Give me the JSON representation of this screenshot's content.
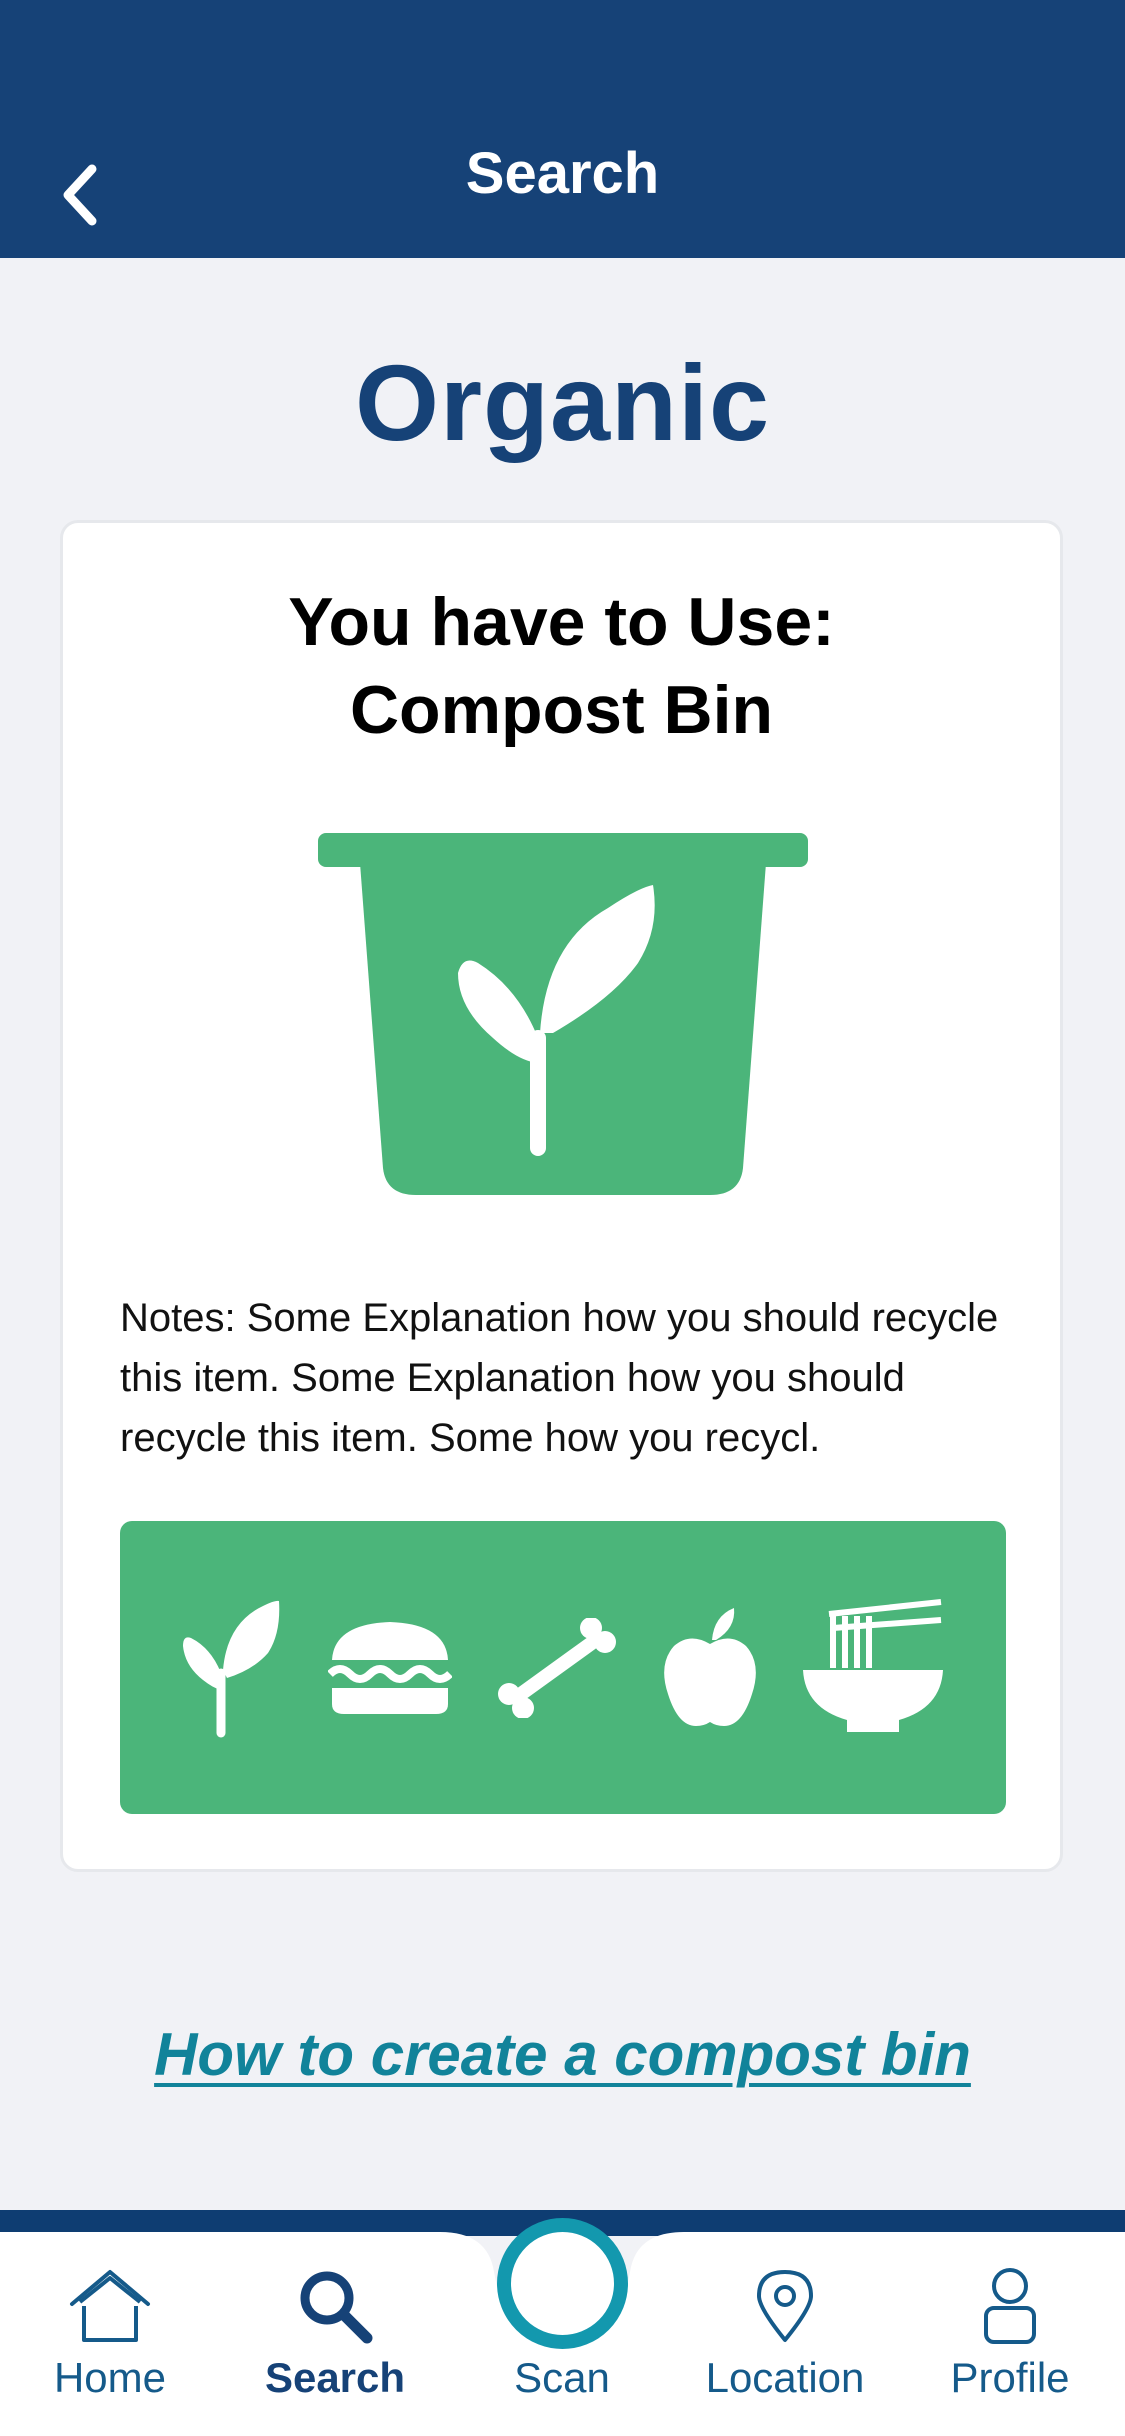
{
  "header": {
    "title": "Search",
    "back_icon": "chevron-left-icon"
  },
  "page": {
    "title": "Organic"
  },
  "card": {
    "heading_line1": "You have to Use:",
    "heading_line2": "Compost Bin",
    "bin_icon": "compost-bin-icon",
    "notes": "Notes: Some Explanation how you should recycle this item. Some Explanation how you should recycle this item. Some how you recycl.",
    "items": [
      {
        "icon": "sprout-icon"
      },
      {
        "icon": "burger-icon"
      },
      {
        "icon": "bone-icon"
      },
      {
        "icon": "apple-icon"
      },
      {
        "icon": "noodle-bowl-icon"
      }
    ]
  },
  "link": {
    "label": "How to create a compost bin"
  },
  "tabbar": {
    "tabs": [
      {
        "label": "Home",
        "icon": "home-icon"
      },
      {
        "label": "Search",
        "icon": "search-icon",
        "active": true
      },
      {
        "label": "Scan",
        "icon": "scan-circle-icon"
      },
      {
        "label": "Location",
        "icon": "location-pin-icon"
      },
      {
        "label": "Profile",
        "icon": "profile-icon"
      }
    ]
  },
  "colors": {
    "header": "#164277",
    "accent_green": "#4bb57a",
    "link": "#11839a",
    "scan_ring": "#1398ae",
    "background": "#f1f2f6"
  }
}
